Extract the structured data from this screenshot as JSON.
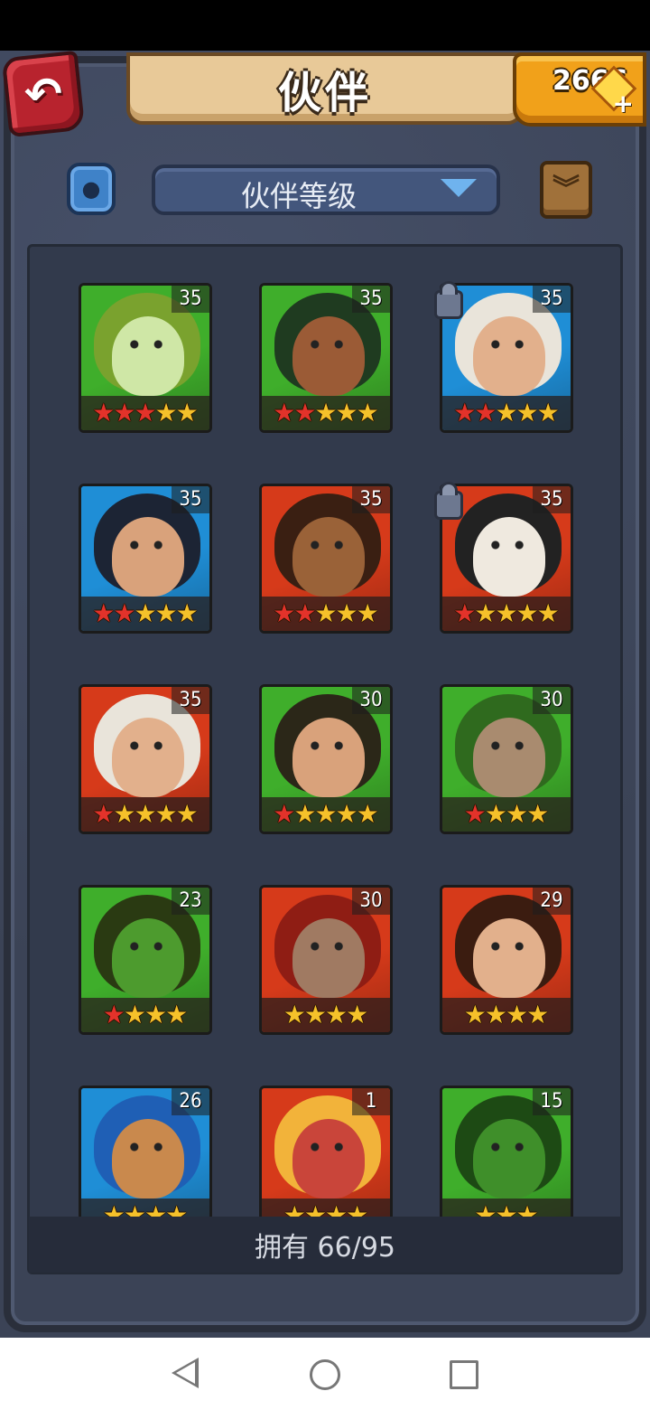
{
  "header": {
    "title": "伙伴",
    "gems": "2666",
    "back_icon": "back-arrow-icon",
    "gem_icon": "gem-plus-icon"
  },
  "filter": {
    "sort_label": "伙伴等级",
    "filter_icon": "element-filter-icon",
    "collapse_icon": "collapse-chevron-icon"
  },
  "companions": [
    {
      "level": "35",
      "stars": [
        1,
        1,
        1,
        0,
        0
      ],
      "bg": "#3fae2b",
      "skin": "#cfe7a6",
      "hair": "#7aa22e",
      "locked": false
    },
    {
      "level": "35",
      "stars": [
        1,
        1,
        0,
        0,
        0
      ],
      "bg": "#3fae2b",
      "skin": "#9b5b36",
      "hair": "#1f3b20",
      "locked": false
    },
    {
      "level": "35",
      "stars": [
        1,
        1,
        0,
        0,
        0
      ],
      "bg": "#1f8ed6",
      "skin": "#e2b08c",
      "hair": "#e9e4da",
      "locked": true
    },
    {
      "level": "35",
      "stars": [
        1,
        1,
        0,
        0,
        0
      ],
      "bg": "#1f8ed6",
      "skin": "#d9a27b",
      "hair": "#1c2434",
      "locked": false
    },
    {
      "level": "35",
      "stars": [
        1,
        1,
        0,
        0,
        0
      ],
      "bg": "#d63a1a",
      "skin": "#9a6238",
      "hair": "#3a1f12",
      "locked": false
    },
    {
      "level": "35",
      "stars": [
        1,
        0,
        0,
        0,
        0
      ],
      "bg": "#d63a1a",
      "skin": "#efe9df",
      "hair": "#222",
      "locked": true
    },
    {
      "level": "35",
      "stars": [
        1,
        0,
        0,
        0,
        0
      ],
      "bg": "#d63a1a",
      "skin": "#e2b08c",
      "hair": "#e9e4da",
      "locked": false
    },
    {
      "level": "30",
      "stars": [
        1,
        0,
        0,
        0,
        0
      ],
      "bg": "#3fae2b",
      "skin": "#d9a27b",
      "hair": "#2b2718",
      "locked": false
    },
    {
      "level": "30",
      "stars": [
        1,
        0,
        0,
        0
      ],
      "bg": "#3fae2b",
      "skin": "#a98b6f",
      "hair": "#2f6a1e",
      "locked": false
    },
    {
      "level": "23",
      "stars": [
        1,
        0,
        0,
        0
      ],
      "bg": "#3fae2b",
      "skin": "#4d9b2e",
      "hair": "#2a3a12",
      "locked": false
    },
    {
      "level": "30",
      "stars": [
        0,
        0,
        0,
        0
      ],
      "bg": "#d63a1a",
      "skin": "#a07a62",
      "hair": "#8f1d14",
      "locked": false
    },
    {
      "level": "29",
      "stars": [
        0,
        0,
        0,
        0
      ],
      "bg": "#d63a1a",
      "skin": "#e2b08c",
      "hair": "#3b1c10",
      "locked": false
    },
    {
      "level": "26",
      "stars": [
        0,
        0,
        0,
        0
      ],
      "bg": "#1f8ed6",
      "skin": "#c9894d",
      "hair": "#1f5fb5",
      "locked": false
    },
    {
      "level": "1",
      "stars": [
        0,
        0,
        0,
        0
      ],
      "bg": "#d63a1a",
      "skin": "#c9453a",
      "hair": "#f2b33a",
      "locked": false
    },
    {
      "level": "15",
      "stars": [
        0,
        0,
        0
      ],
      "bg": "#3fae2b",
      "skin": "#3f8f2a",
      "hair": "#1d4a14",
      "locked": false
    }
  ],
  "footer": {
    "owned_label": "拥有 66/95"
  },
  "colors": {
    "star_red": "#e3322a",
    "star_gold": "#f5c12a",
    "panel": "#323a4c",
    "gem_bar": "#f1a11a"
  }
}
